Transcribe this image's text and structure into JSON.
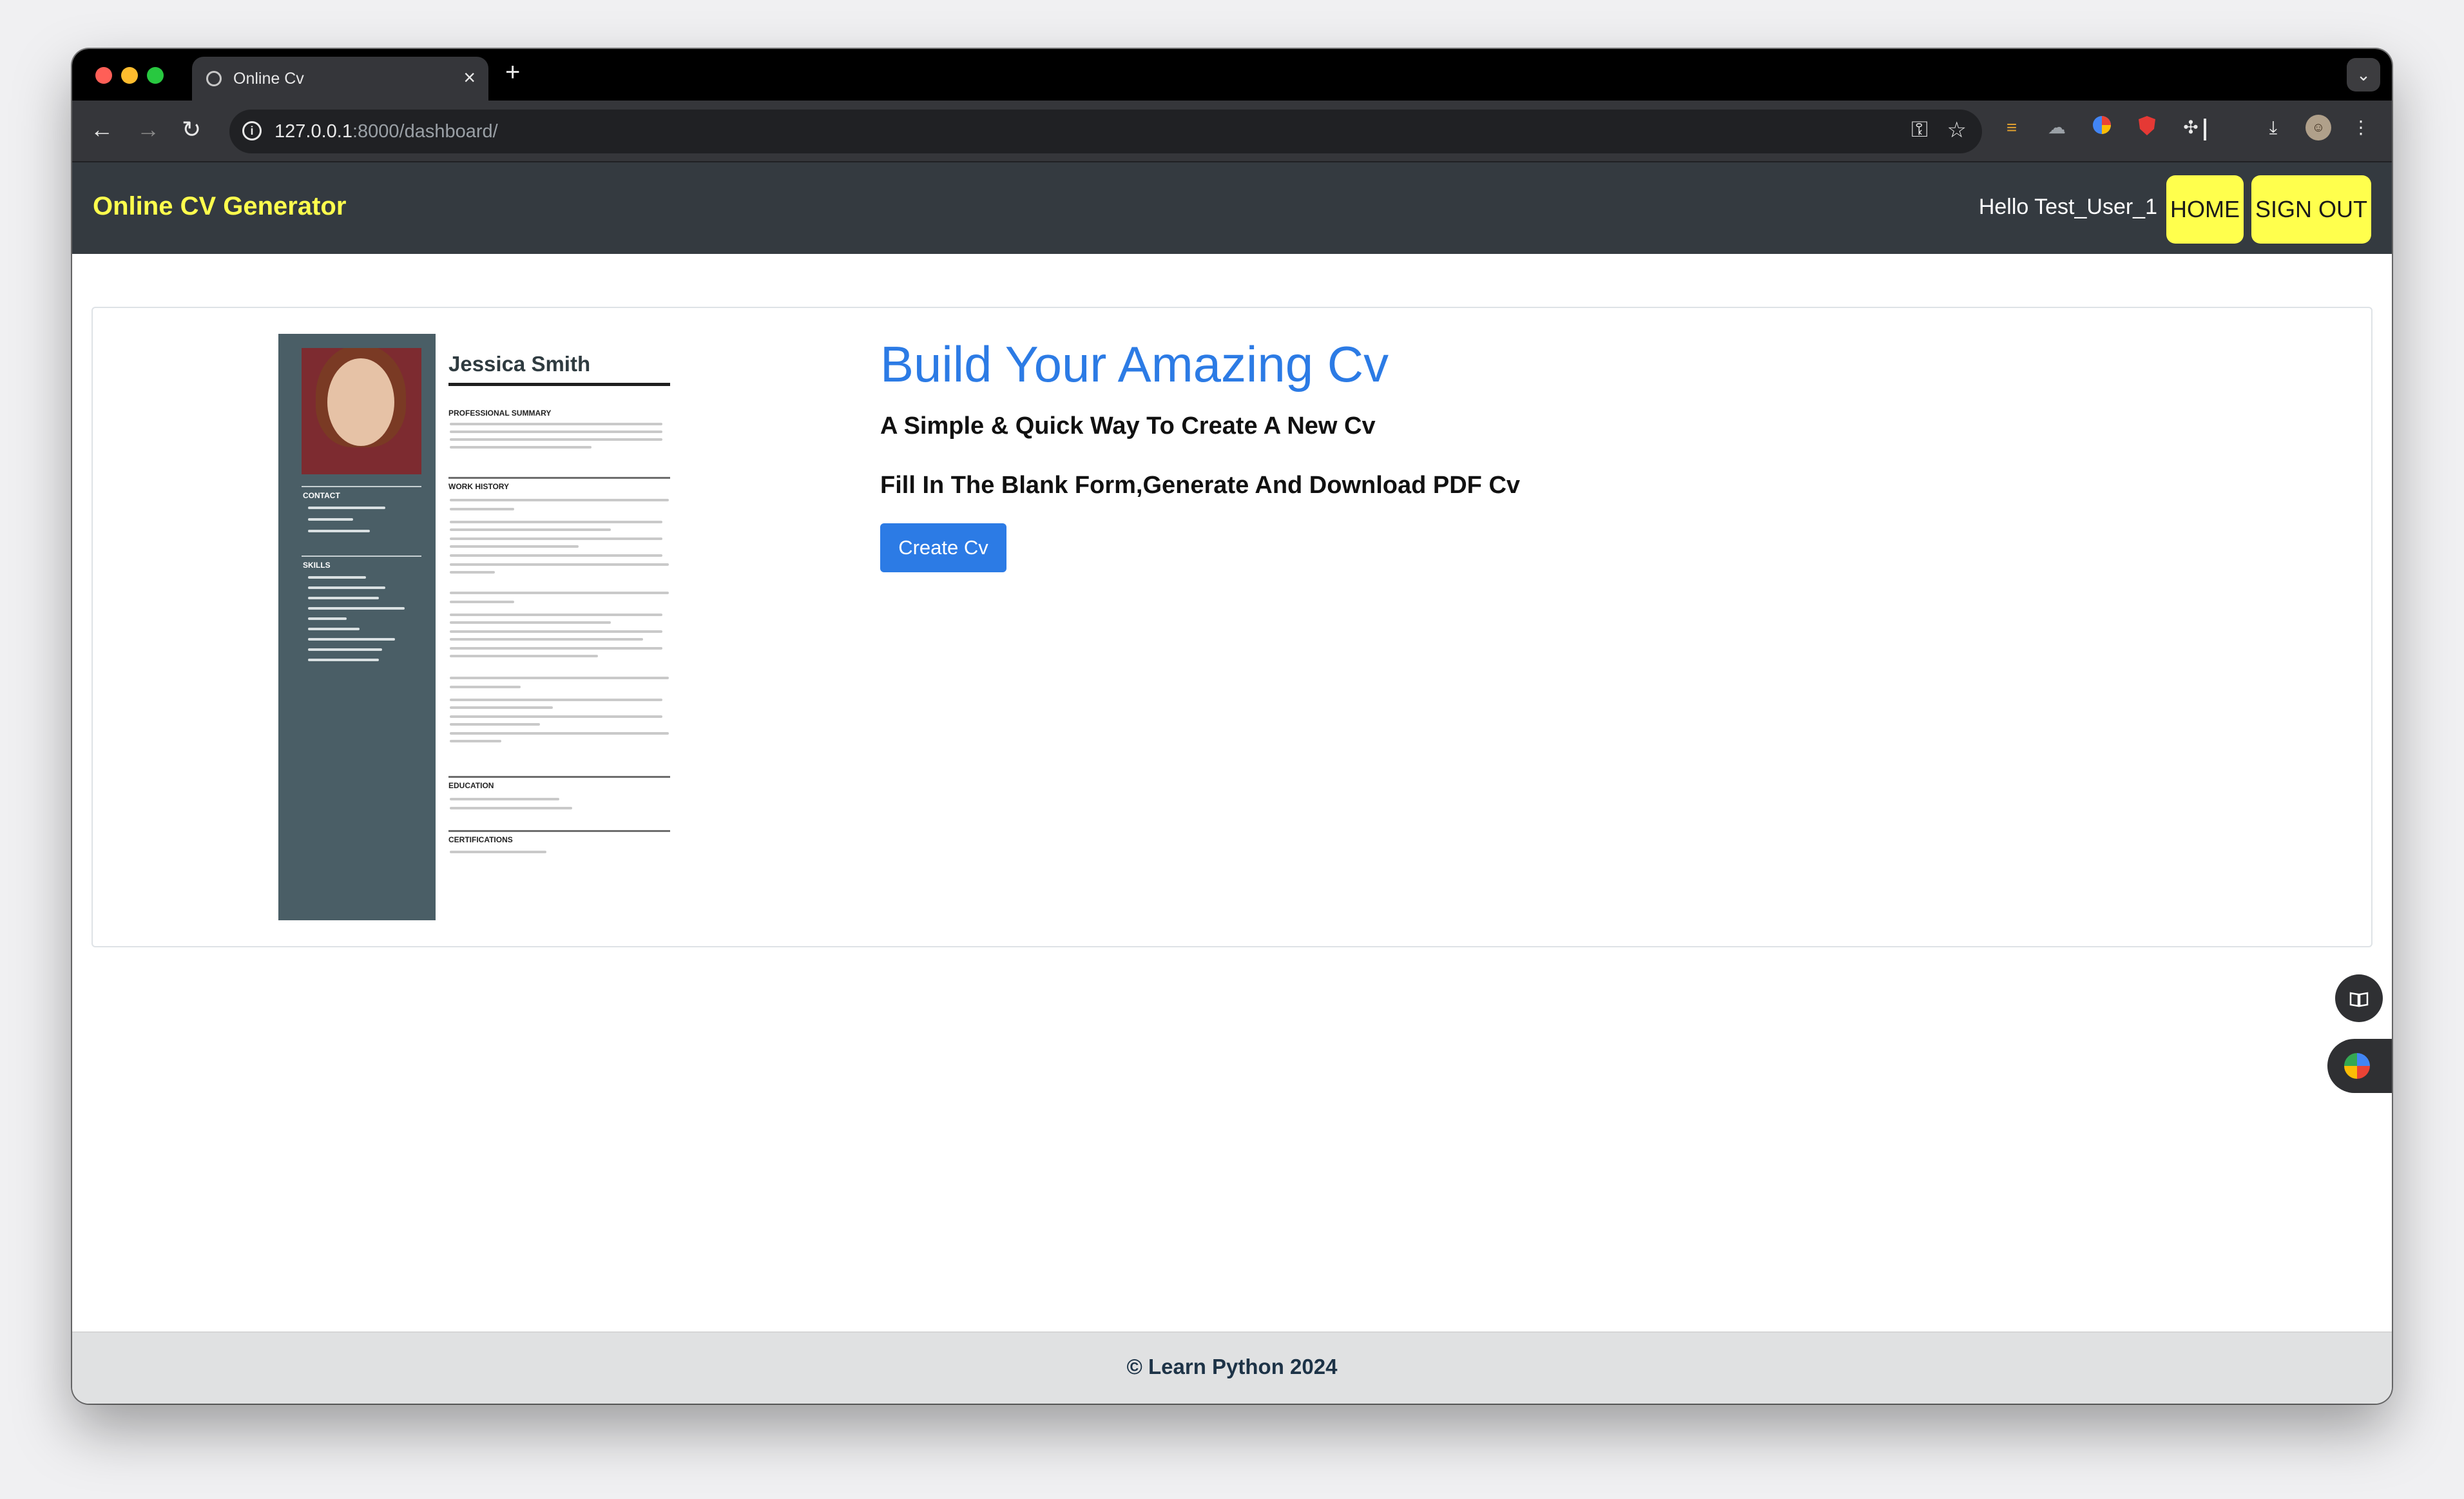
{
  "browser": {
    "tab_title": "Online Cv",
    "tab_close": "×",
    "new_tab": "+",
    "tab_menu": "⌄",
    "url_host": "127.0.0.1",
    "url_path": ":8000/dashboard/",
    "traffic_lights": [
      "#ff5f57",
      "#febc2e",
      "#28c840"
    ],
    "nav": {
      "back": "←",
      "forward": "→",
      "reload": "↻"
    }
  },
  "navbar": {
    "brand": "Online CV Generator",
    "greeting": "Hello Test_User_1",
    "home": "HOME",
    "sign_out": "SIGN OUT",
    "accent": "#ffff4d"
  },
  "hero": {
    "title": "Build Your Amazing Cv",
    "subtitle1": "A Simple & Quick Way To Create A New Cv",
    "subtitle2": "Fill In The Blank Form,Generate And Download PDF Cv",
    "button": "Create Cv",
    "accent": "#2c7be5"
  },
  "cv_preview": {
    "name": "Jessica Smith",
    "sections": [
      "PROFESSIONAL SUMMARY",
      "WORK HISTORY",
      "EDUCATION",
      "CERTIFICATIONS"
    ],
    "sidebar_sections": [
      "CONTACT",
      "SKILLS"
    ]
  },
  "footer": {
    "text": "© Learn Python 2024"
  }
}
